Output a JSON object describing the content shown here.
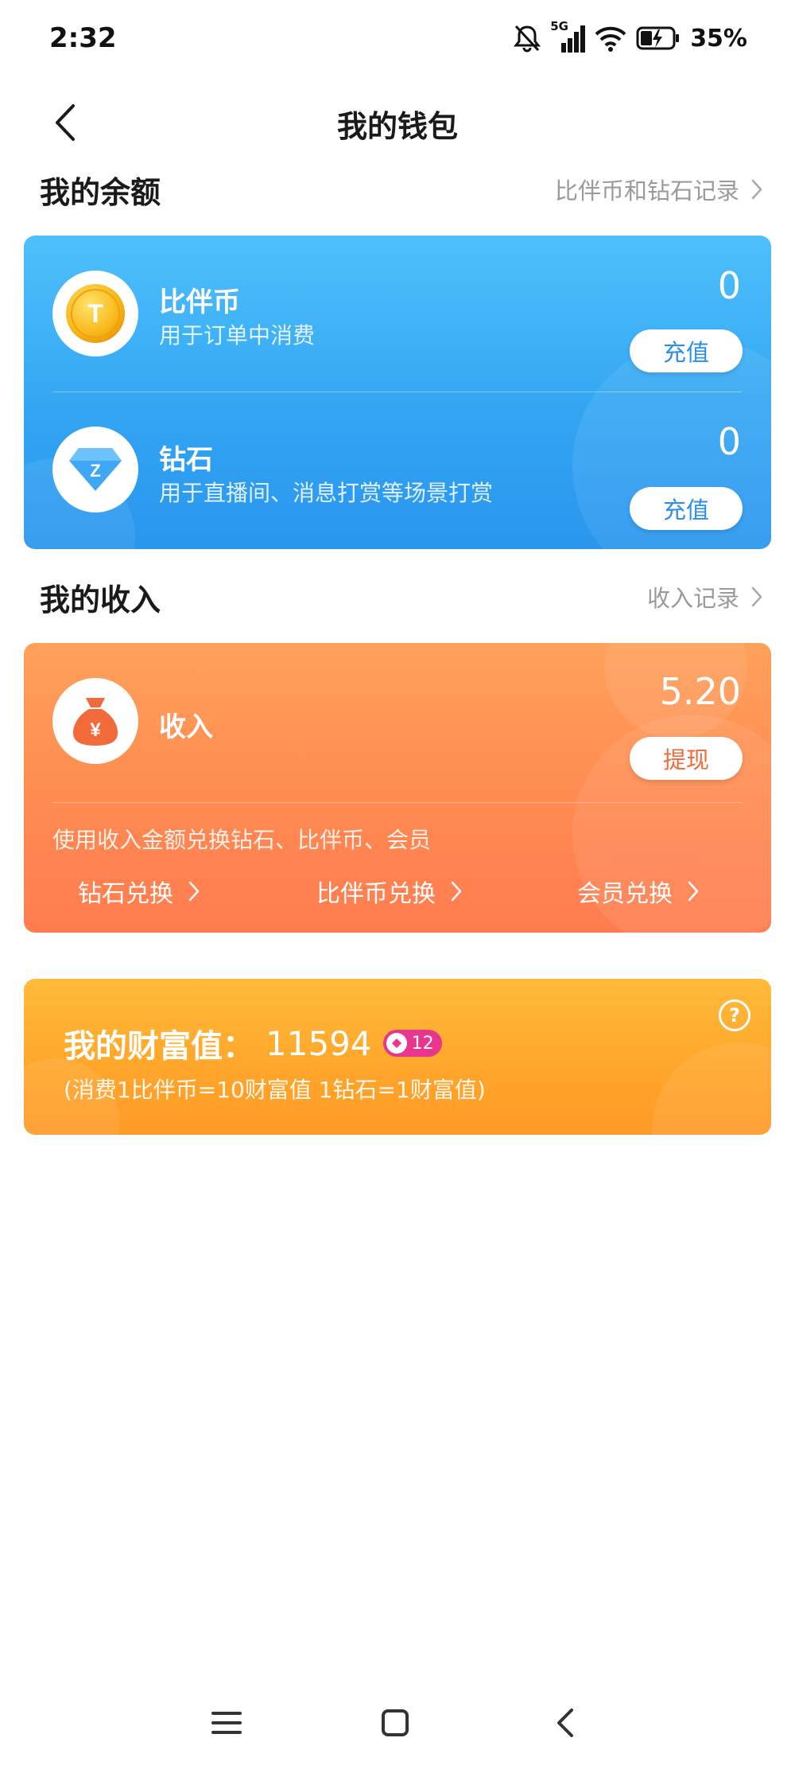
{
  "status_bar": {
    "time": "2:32",
    "network": "5G",
    "battery_percent": "35%",
    "icons": [
      "bell-muted-icon",
      "signal-icon",
      "wifi-icon",
      "battery-charging-icon"
    ]
  },
  "nav": {
    "title": "我的钱包",
    "back_icon": "chevron-left-icon"
  },
  "balance_section": {
    "title": "我的余额",
    "link_label": "比伴币和钻石记录",
    "items": [
      {
        "name": "比伴币",
        "desc": "用于订单中消费",
        "value": "0",
        "button": "充值",
        "icon": "coin-icon",
        "icon_letter": "T"
      },
      {
        "name": "钻石",
        "desc": "用于直播间、消息打赏等场景打赏",
        "value": "0",
        "button": "充值",
        "icon": "diamond-icon",
        "icon_letter": "Z"
      }
    ]
  },
  "income_section": {
    "title": "我的收入",
    "link_label": "收入记录",
    "name": "收入",
    "value": "5.20",
    "button": "提现",
    "icon": "money-bag-icon",
    "icon_symbol": "¥",
    "desc": "使用收入金额兑换钻石、比伴币、会员",
    "exchanges": [
      "钻石兑换",
      "比伴币兑换",
      "会员兑换"
    ]
  },
  "wealth": {
    "label": "我的财富值：",
    "value": "11594",
    "level": "12",
    "note": "(消费1比伴币=10财富值 1钻石=1财富值)",
    "help_icon": "question-circle-icon",
    "help_symbol": "?"
  },
  "colors": {
    "balance_card": "#33a6f3",
    "income_card": "#ff8a52",
    "wealth_card": "#ffa52a",
    "level_badge": "#e8368f"
  }
}
